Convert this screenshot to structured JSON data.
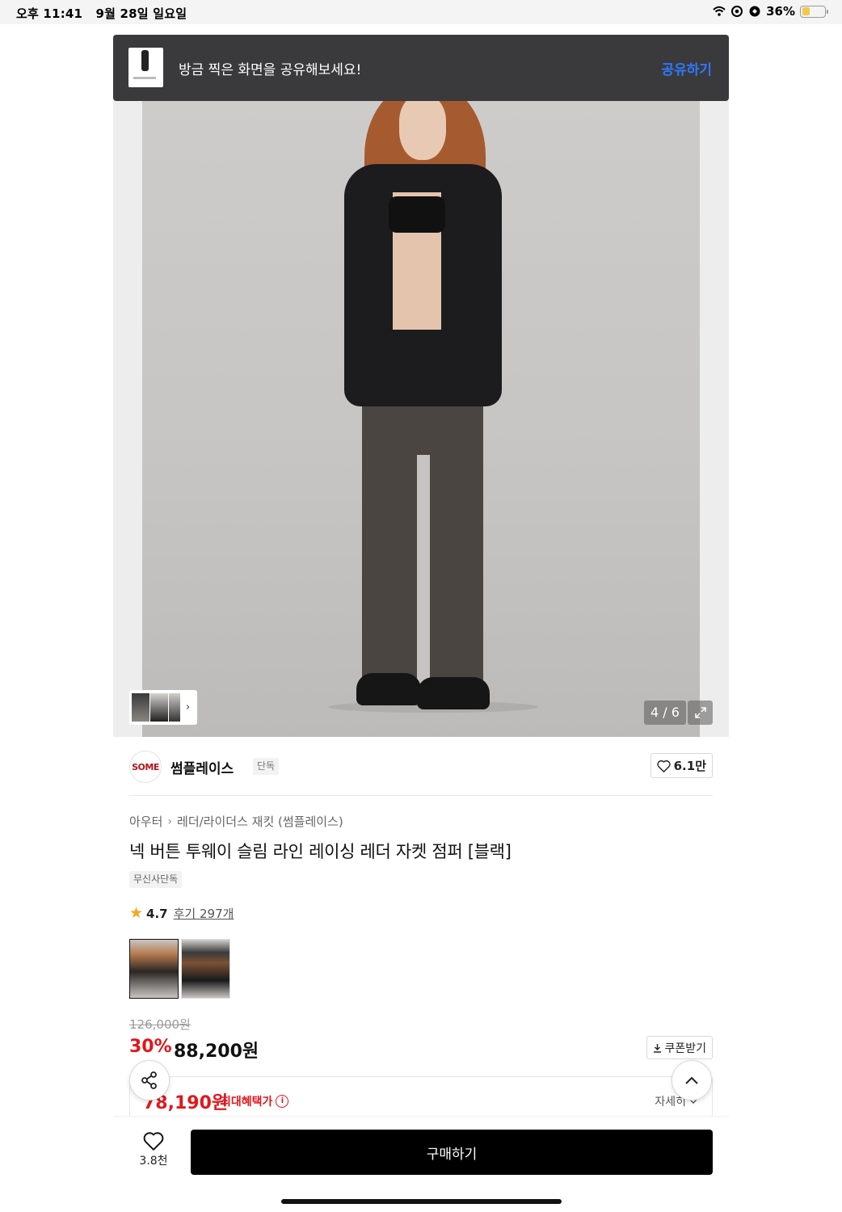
{
  "status_bar": {
    "time": "오후 11:41",
    "date": "9월 28일 일요일",
    "battery": "36%",
    "battery_level": 0.36,
    "icons": [
      "wifi-icon",
      "location-icon",
      "vpn-icon",
      "battery-icon"
    ]
  },
  "share_banner": {
    "text": "방금 찍은 화면을 공유해보세요!",
    "action": "공유하기",
    "action_color": "#2f78ff"
  },
  "gallery": {
    "counter": "4 / 6",
    "icons": [
      "chevron-right-icon",
      "expand-icon"
    ]
  },
  "brand": {
    "logo_text": "SOME",
    "name": "썸플레이스",
    "tag": "단독",
    "likes": "6.1만"
  },
  "breadcrumb": {
    "items": [
      "아우터",
      "레더/라이더스 재킷 (썸플레이스)"
    ]
  },
  "product": {
    "title": "넥 버튼 투웨이 슬림 라인 레이싱 레더 자켓 점퍼 [블랙]",
    "exclusive_tag": "무신사단독",
    "rating": "4.7",
    "reviews": "후기 297개"
  },
  "price": {
    "original": "126,000원",
    "discount": "30%",
    "sale": "88,200원",
    "coupon_button": "쿠폰받기",
    "max_benefit_price": "78,190원",
    "max_benefit_label": "최대혜택가",
    "details": "자세히",
    "accent_color": "#e2171d"
  },
  "bottom_bar": {
    "wish_count": "3.8천",
    "buy_button": "구매하기"
  }
}
